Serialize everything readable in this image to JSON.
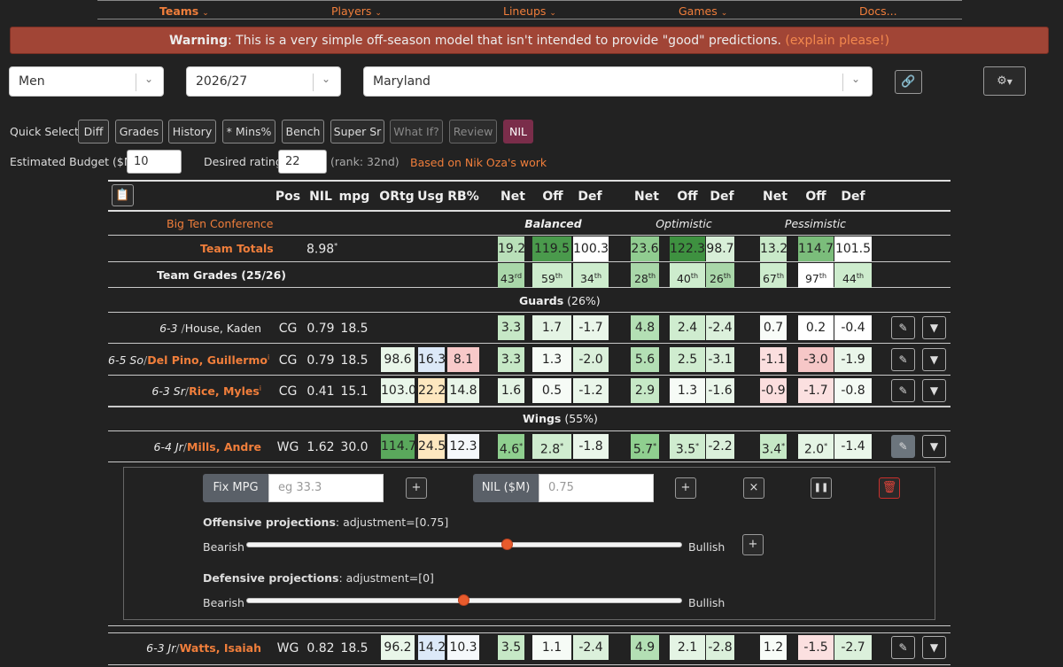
{
  "nav": {
    "items": [
      "Teams",
      "Players",
      "Lineups",
      "Games",
      "Docs..."
    ]
  },
  "warning": {
    "bold": "Warning",
    "text": ": This is a very simple off-season model that isn't intended to provide \"good\" predictions. ",
    "link": "(explain please!)"
  },
  "selectors": {
    "gender": "Men",
    "year": "2026/27",
    "team": "Maryland"
  },
  "quick_select": {
    "label": "Quick Select:",
    "buttons": [
      "Diff",
      "Grades",
      "History",
      "* Mins%",
      "Bench",
      "Super Sr",
      "What If?",
      "Review",
      "NIL"
    ]
  },
  "budget": {
    "label": "Estimated Budget ($M):",
    "value": "10",
    "rating_label": "Desired rating:",
    "rating_value": "22",
    "rank": "(rank: 32nd)",
    "credit": "Based on Nik Oza's work"
  },
  "table": {
    "headers": [
      "Pos",
      "NIL",
      "mpg",
      "ORtg",
      "Usg",
      "RB%",
      "Net",
      "Off",
      "Def",
      "Net",
      "Off",
      "Def",
      "Net",
      "Off",
      "Def"
    ],
    "scenarios": [
      "Balanced",
      "Optimistic",
      "Pessimistic"
    ],
    "conference": "Big Ten Conference",
    "totals": {
      "label": "Team Totals",
      "nil": "8.98",
      "vals": [
        "19.2",
        "119.5",
        "100.3",
        "23.6",
        "122.3",
        "98.7",
        "13.2",
        "114.7",
        "101.5"
      ]
    },
    "grades": {
      "label": "Team Grades (25/26)",
      "vals": [
        [
          "43",
          "rd"
        ],
        [
          "59",
          "th"
        ],
        [
          "34",
          "th"
        ],
        [
          "28",
          "th"
        ],
        [
          "40",
          "th"
        ],
        [
          "26",
          "th"
        ],
        [
          "67",
          "th"
        ],
        [
          "97",
          "th"
        ],
        [
          "44",
          "th"
        ]
      ]
    },
    "guards_label": "Guards",
    "guards_pct": "(26%)",
    "wings_label": "Wings",
    "wings_pct": "(55%)",
    "players": [
      {
        "ht": "6-3",
        "yr": "",
        "name": "House, Kaden",
        "pos": "CG",
        "nil": "0.79",
        "mpg": "18.5",
        "ortg": "",
        "usg": "",
        "rb": "",
        "v": [
          "3.3",
          "1.7",
          "-1.7",
          "4.8",
          "2.4",
          "-2.4",
          "0.7",
          "0.2",
          "-0.4"
        ]
      },
      {
        "ht": "6-5",
        "yr": "So",
        "name": "Del Pino, Guillermo",
        "pos": "CG",
        "nil": "0.79",
        "mpg": "18.5",
        "ortg": "98.6",
        "usg": "16.3",
        "rb": "8.1",
        "v": [
          "3.3",
          "1.3",
          "-2.0",
          "5.6",
          "2.5",
          "-3.1",
          "-1.1",
          "-3.0",
          "-1.9"
        ]
      },
      {
        "ht": "6-3",
        "yr": "Sr",
        "name": "Rice, Myles",
        "pos": "CG",
        "nil": "0.41",
        "mpg": "15.1",
        "ortg": "103.0",
        "usg": "22.2",
        "rb": "14.8",
        "v": [
          "1.6",
          "0.5",
          "-1.2",
          "2.9",
          "1.3",
          "-1.6",
          "-0.9",
          "-1.7",
          "-0.8"
        ]
      },
      {
        "ht": "6-4",
        "yr": "Jr",
        "name": "Mills, Andre",
        "pos": "WG",
        "nil": "1.62",
        "mpg": "30.0",
        "ortg": "114.7",
        "usg": "24.5",
        "rb": "12.3",
        "v": [
          "4.6",
          "2.8",
          "-1.8",
          "5.7",
          "3.5",
          "-2.2",
          "3.4",
          "2.0",
          "-1.4"
        ]
      },
      {
        "ht": "6-3",
        "yr": "Jr",
        "name": "Watts, Isaiah",
        "pos": "WG",
        "nil": "0.82",
        "mpg": "18.5",
        "ortg": "96.2",
        "usg": "14.2",
        "rb": "10.3",
        "v": [
          "3.5",
          "1.1",
          "-2.4",
          "4.9",
          "2.1",
          "-2.8",
          "1.2",
          "-1.5",
          "-2.7"
        ]
      }
    ]
  },
  "editor": {
    "fix_mpg": "Fix MPG",
    "mpg_placeholder": "eg 33.3",
    "nil_label": "NIL ($M)",
    "nil_placeholder": "0.75",
    "off_label": "Offensive projections",
    "off_adj": ": adjustment=[0.75]",
    "def_label": "Defensive projections",
    "def_adj": ": adjustment=[0]",
    "bearish": "Bearish",
    "bullish": "Bullish",
    "off_level": 0.6,
    "def_level": 0.5
  },
  "colors": {
    "accent": "#f07e3b",
    "nil_active": "#7a2d4a",
    "warning_bg": "#a14536"
  }
}
